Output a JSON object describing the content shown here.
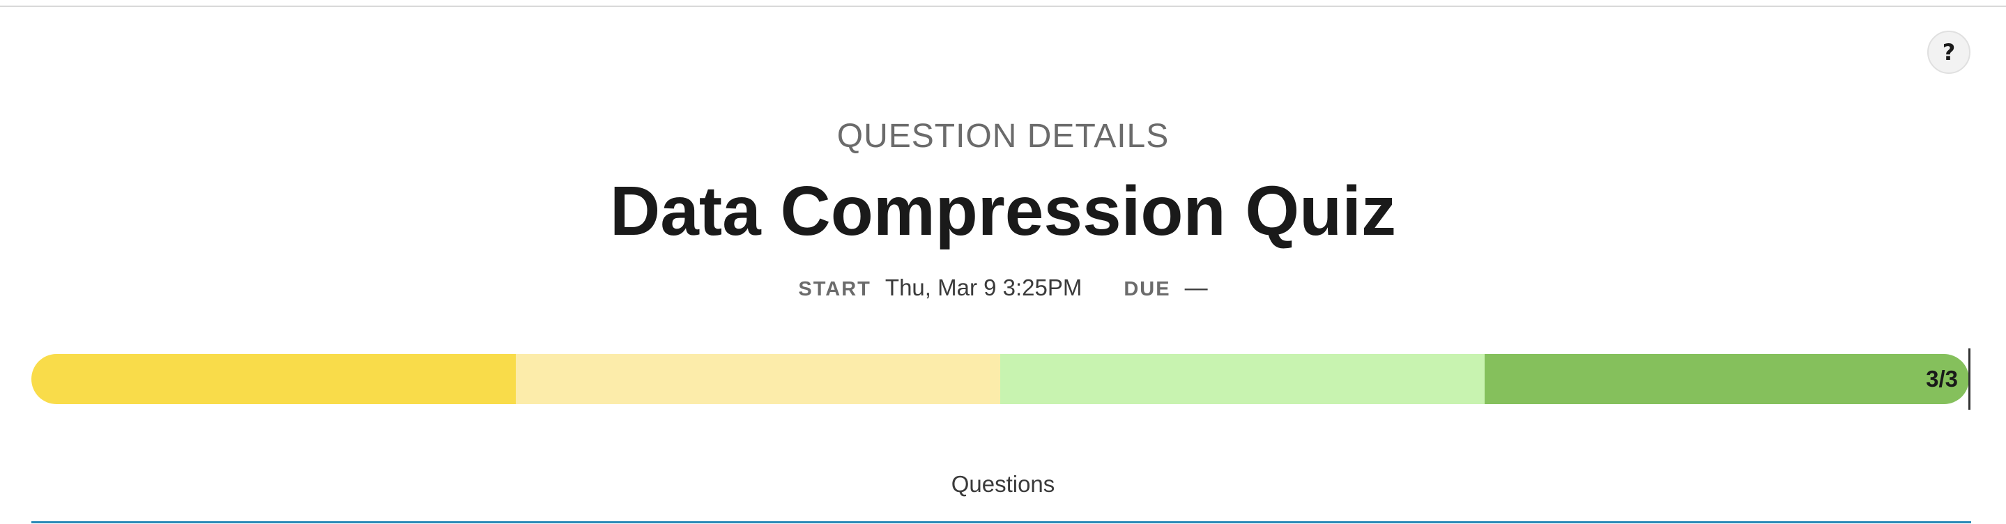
{
  "help": {
    "label": "?"
  },
  "header": {
    "section_label": "QUESTION DETAILS",
    "title": "Data Compression Quiz",
    "meta": {
      "start_label": "START",
      "start_value": "Thu, Mar 9 3:25PM",
      "due_label": "DUE",
      "due_value": "—"
    }
  },
  "progress": {
    "completed": 3,
    "total": 3,
    "label": "3/3",
    "segment_colors": [
      "#f9dc4a",
      "#fcecaa",
      "#c8f3b0",
      "#85c05c"
    ]
  },
  "tabs": {
    "questions_label": "Questions"
  },
  "colors": {
    "accent": "#2a8ab7"
  }
}
